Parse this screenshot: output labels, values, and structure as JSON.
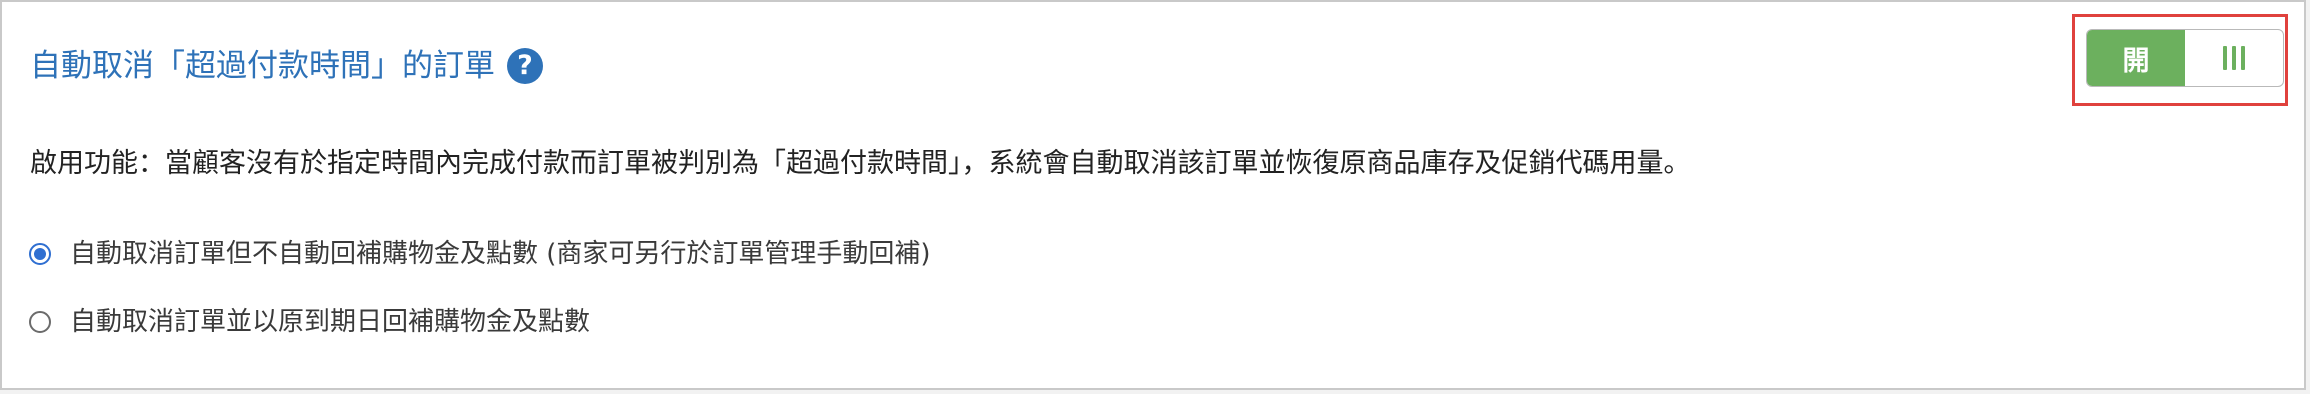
{
  "setting": {
    "title": "自動取消「超過付款時間」的訂單",
    "help_icon": "question-circle-icon",
    "description": "啟用功能：當顧客沒有於指定時間內完成付款而訂單被判別為「超過付款時間」，系統會自動取消該訂單並恢復原商品庫存及促銷代碼用量。",
    "toggle": {
      "state_label": "開",
      "enabled": true,
      "handle_icon": "grip-lines-icon",
      "color": "#6cb05e"
    },
    "options": [
      {
        "label": "自動取消訂單但不自動回補購物金及點數 (商家可另行於訂單管理手動回補)",
        "selected": true
      },
      {
        "label": "自動取消訂單並以原到期日回補購物金及點數",
        "selected": false
      }
    ]
  },
  "colors": {
    "title": "#2e72b8",
    "highlight_border": "#e0413d",
    "radio_selected": "#2f6fd1"
  }
}
